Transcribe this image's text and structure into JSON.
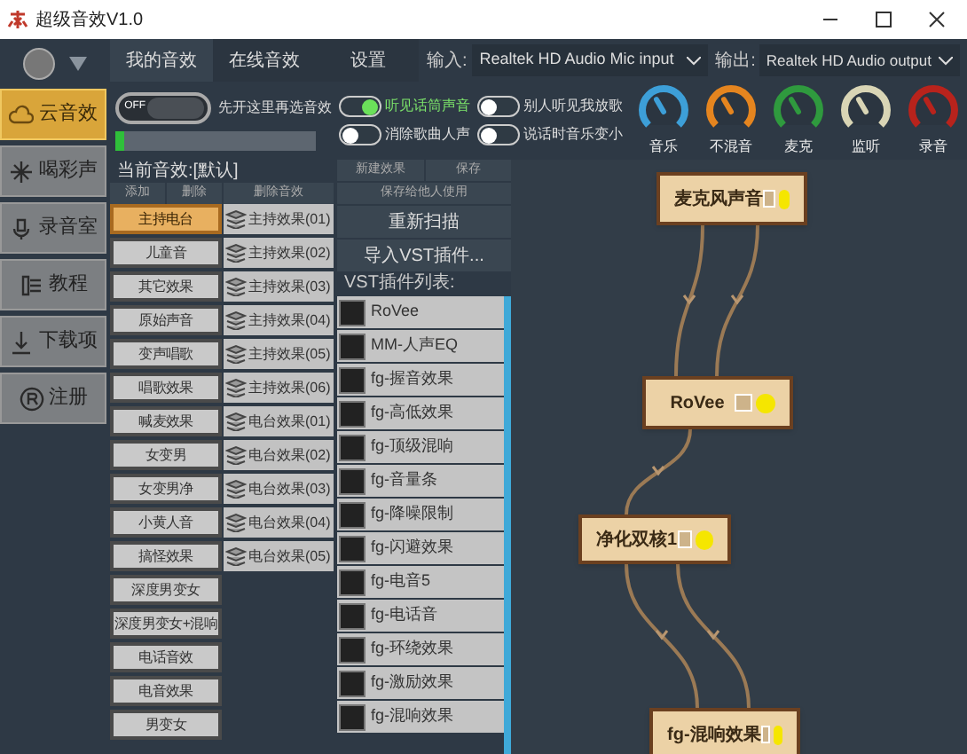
{
  "window": {
    "title": "超级音效V1.0"
  },
  "sidebar": {
    "items": [
      {
        "label": "云音效",
        "selected": true
      },
      {
        "label": "喝彩声",
        "selected": false
      },
      {
        "label": "录音室",
        "selected": false
      },
      {
        "label": "教程",
        "selected": false
      },
      {
        "label": "下载项",
        "selected": false
      },
      {
        "label": "注册",
        "selected": false
      }
    ]
  },
  "tabs": [
    {
      "label": "我的音效",
      "selected": true
    },
    {
      "label": "在线音效",
      "selected": false
    },
    {
      "label": "设置",
      "selected": false
    }
  ],
  "input": {
    "label": "输入:",
    "value": "Realtek HD Audio Mic input"
  },
  "output": {
    "label": "输出:",
    "value": "Realtek HD Audio output"
  },
  "power": {
    "on": false,
    "state_label": "OFF",
    "hint": "先开这里再选音效",
    "level": 0.04
  },
  "toggles": [
    {
      "label": "听见话筒声音",
      "on": true
    },
    {
      "label": "别人听见我放歌",
      "on": false
    },
    {
      "label": "消除歌曲人声",
      "on": false
    },
    {
      "label": "说话时音乐变小",
      "on": false
    }
  ],
  "knobs": [
    {
      "label": "音乐",
      "color": "#3d9fd8"
    },
    {
      "label": "不混音",
      "color": "#e5851f"
    },
    {
      "label": "麦克",
      "color": "#2f9a3e"
    },
    {
      "label": "监听",
      "color": "#d9d5b5"
    },
    {
      "label": "录音",
      "color": "#b8231c"
    }
  ],
  "current_effect": "当前音效:[默认]",
  "list_buttons": [
    "添加",
    "删除",
    "删除音效"
  ],
  "effect_buttons": [
    "新建效果",
    "保存"
  ],
  "share_button": "保存给他人使用",
  "categories": [
    {
      "label": "主持电台",
      "selected": true
    },
    {
      "label": "儿童音",
      "selected": false
    },
    {
      "label": "其它效果",
      "selected": false
    },
    {
      "label": "原始声音",
      "selected": false
    },
    {
      "label": "变声唱歌",
      "selected": false
    },
    {
      "label": "唱歌效果",
      "selected": false
    },
    {
      "label": "喊麦效果",
      "selected": false
    },
    {
      "label": "女变男",
      "selected": false
    },
    {
      "label": "女变男净",
      "selected": false
    },
    {
      "label": "小黄人音",
      "selected": false
    },
    {
      "label": "搞怪效果",
      "selected": false
    },
    {
      "label": "深度男变女",
      "selected": false
    },
    {
      "label": "深度男变女+混响",
      "selected": false
    },
    {
      "label": "电话音效",
      "selected": false
    },
    {
      "label": "电音效果",
      "selected": false
    },
    {
      "label": "男变女",
      "selected": false
    }
  ],
  "presets": [
    "主持效果(01)",
    "主持效果(02)",
    "主持效果(03)",
    "主持效果(04)",
    "主持效果(05)",
    "主持效果(06)",
    "电台效果(01)",
    "电台效果(02)",
    "电台效果(03)",
    "电台效果(04)",
    "电台效果(05)"
  ],
  "rescan_button": "重新扫描",
  "import_button": "导入VST插件...",
  "vst_list": {
    "title": "VST插件列表:",
    "items": [
      "RoVee",
      "MM-人声EQ",
      "fg-握音效果",
      "fg-高低效果",
      "fg-顶级混响",
      "fg-音量条",
      "fg-降噪限制",
      "fg-闪避效果",
      "fg-电音5",
      "fg-电话音",
      "fg-环绕效果",
      "fg-激励效果",
      "fg-混响效果"
    ]
  },
  "graph": {
    "nodes": [
      {
        "label": "麦克风声音"
      },
      {
        "label": "RoVee"
      },
      {
        "label": "净化双核1"
      },
      {
        "label": "fg-混响效果"
      }
    ]
  }
}
